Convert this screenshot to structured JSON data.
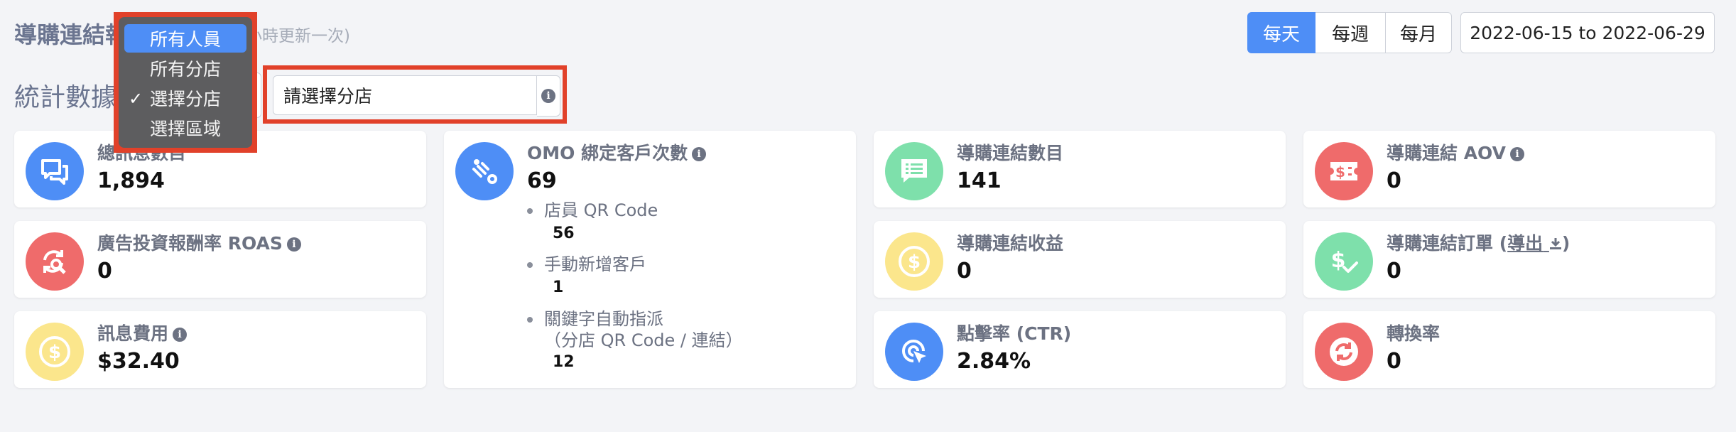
{
  "header": {
    "title": "導購連結報",
    "note": "小時更新一次)",
    "stats_title": "統計數據"
  },
  "period": {
    "buttons": [
      "每天",
      "每週",
      "每月"
    ],
    "active_index": 0,
    "date_range": "2022-06-15 to 2022-06-29"
  },
  "filter": {
    "dropdown": {
      "options": [
        "所有人員",
        "所有分店",
        "選擇分店",
        "選擇區域"
      ],
      "highlighted_option": "所有人員",
      "checked_option": "選擇分店",
      "checkmark": "✓"
    },
    "branch_placeholder": "請選擇分店",
    "info_icon": "info-icon"
  },
  "cards": {
    "total_messages": {
      "label": "總訊息數目",
      "value": "1,894",
      "icon": "chat-bubbles-icon",
      "color": "#4e8ef6"
    },
    "roas": {
      "label": "廣告投資報酬率 ROAS",
      "value": "0",
      "icon": "refresh-search-icon",
      "color": "#ef6b6b"
    },
    "message_cost": {
      "label": "訊息費用",
      "value": "$32.40",
      "icon": "dollar-coin-icon",
      "color": "#fbe68c"
    },
    "omo": {
      "label": "OMO 綁定客戶次數",
      "value": "69",
      "icon": "binding-link-icon",
      "color": "#4e8ef6",
      "items": [
        {
          "label": "店員 QR Code",
          "value": "56"
        },
        {
          "label": "手動新增客戶",
          "value": "1"
        },
        {
          "label": "關鍵字自動指派",
          "sublabel": "（分店 QR Code / 連結）",
          "value": "12"
        }
      ]
    },
    "link_count": {
      "label": "導購連結數目",
      "value": "141",
      "icon": "list-message-icon",
      "color": "#7ee0ab"
    },
    "link_revenue": {
      "label": "導購連結收益",
      "value": "0",
      "icon": "dollar-coin-icon",
      "color": "#fbe68c"
    },
    "ctr": {
      "label": "點擊率 (CTR)",
      "value": "2.84%",
      "icon": "click-target-icon",
      "color": "#4e8ef6"
    },
    "aov": {
      "label": "導購連結 AOV",
      "value": "0",
      "icon": "dollar-ticket-icon",
      "color": "#ef6b6b"
    },
    "orders": {
      "label": "導購連結訂單",
      "export_label": "導出",
      "value": "0",
      "icon": "dollar-check-icon",
      "color": "#7ee0ab"
    },
    "conversion": {
      "label": "轉換率",
      "value": "0",
      "icon": "refresh-icon",
      "color": "#ef6b6b"
    }
  }
}
